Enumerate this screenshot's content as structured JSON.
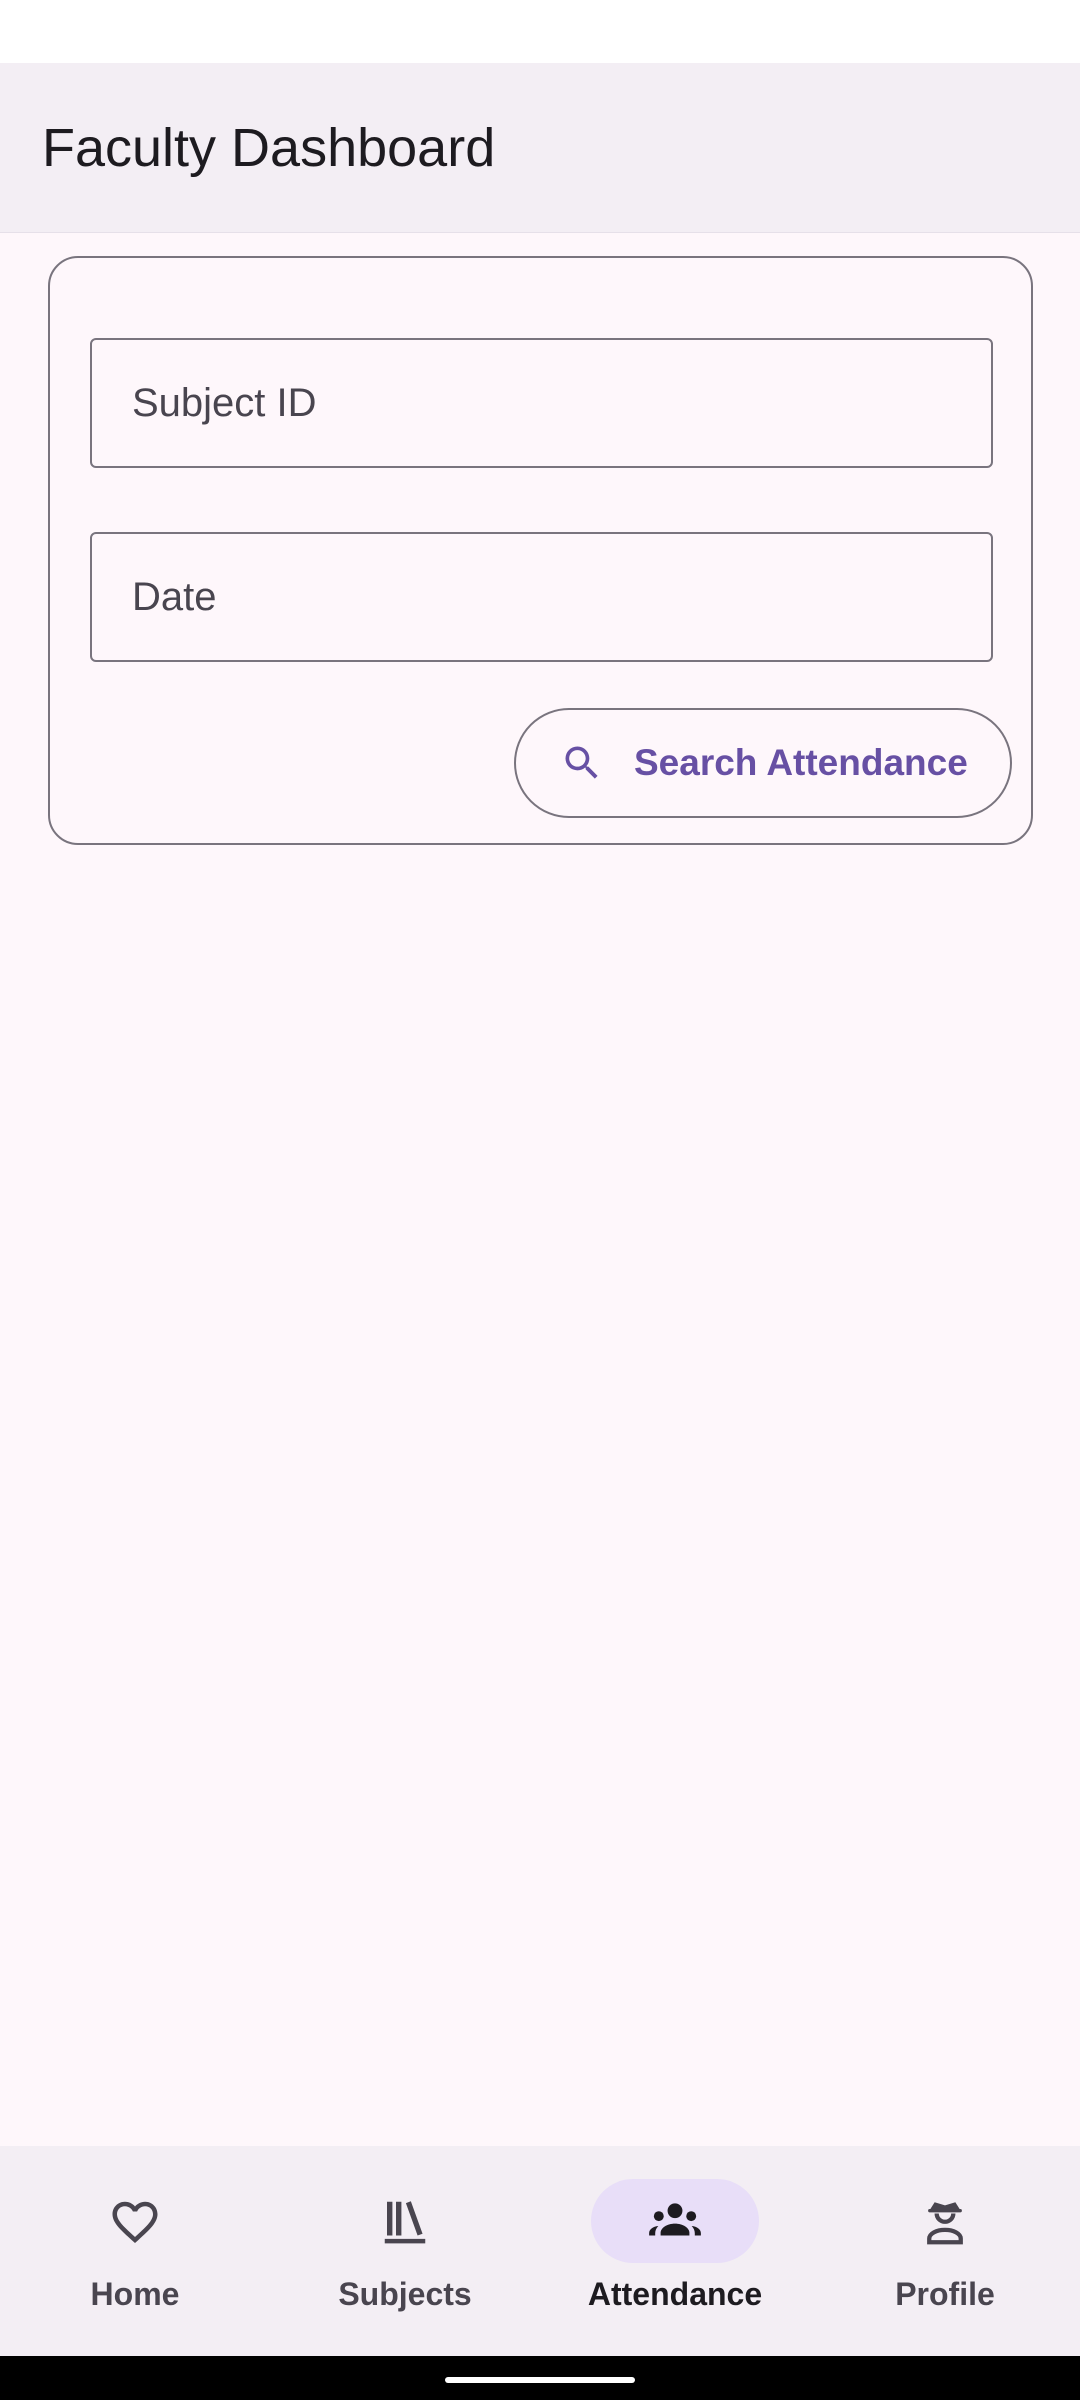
{
  "app_bar": {
    "title": "Faculty Dashboard"
  },
  "search_form": {
    "subject_placeholder": "Subject ID",
    "subject_value": "",
    "date_placeholder": "Date",
    "date_value": "",
    "search_button_label": "Search Attendance",
    "search_icon": "search-icon"
  },
  "bottom_nav": {
    "items": [
      {
        "label": "Home",
        "icon": "heart-icon",
        "active": false
      },
      {
        "label": "Subjects",
        "icon": "library-books-icon",
        "active": false
      },
      {
        "label": "Attendance",
        "icon": "groups-icon",
        "active": true
      },
      {
        "label": "Profile",
        "icon": "person-with-hat-icon",
        "active": false
      }
    ]
  },
  "colors": {
    "primary": "#6750a4",
    "background": "#fef7fb",
    "surface_container": "#f3eef4",
    "active_indicator": "#e8def8",
    "outline": "#79747e"
  }
}
